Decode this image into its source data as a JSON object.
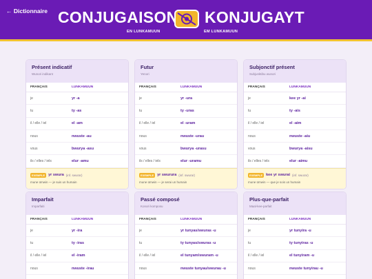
{
  "header": {
    "back_label": "← Dictionnaire",
    "title_left": "CONJUGAISON",
    "title_right": "KONJUGAYT",
    "sub_left": "EN LUNKAMUUN",
    "sub_right": "EM LUNKAMUUN",
    "colors": {
      "background": "#6a1bb5",
      "accent": "#f2c230"
    }
  },
  "columns": {
    "fr": "FRANÇAIS",
    "lk": "LUNKAMUUN"
  },
  "pronouns": [
    "je",
    "tu",
    "il / elle / iel",
    "nous",
    "vous",
    "ils / elles / iels"
  ],
  "cards": [
    {
      "title": "Présent indicatif",
      "subtitle": "Wunori indikant",
      "forms": [
        "yr -a",
        "ty -as",
        "el -am",
        "nwuste -au",
        "bwurya -asu",
        "elur -amu"
      ],
      "example": {
        "badge": "EXEMPLE",
        "text": "yr swura",
        "pron": "(inf. swurar)",
        "trans": "mune ümwin — je suis un humain"
      }
    },
    {
      "title": "Futur",
      "subtitle": "Yenori",
      "forms": [
        "yr -ura",
        "ty -uras",
        "el -uram",
        "nwuste -urau",
        "bwurya -urasu",
        "elur -uramu"
      ],
      "example": {
        "badge": "EXEMPLE",
        "text": "yr swurura",
        "pron": "(inf. swurar)",
        "trans": "mune ümwin — je serai un humain"
      }
    },
    {
      "title": "Subjonctif présent",
      "subtitle": "Subjunktibu wunori",
      "forms": [
        "kee yr -ai",
        "ty -ais",
        "el -aim",
        "nwuste -aiu",
        "bwurya -aisu",
        "elur -aimu"
      ],
      "example": {
        "badge": "EXEMPLE",
        "text": "kee yr swurai",
        "pron": "(inf. swurar)",
        "trans": "mune ümwin — que je sois un humain"
      }
    },
    {
      "title": "Imparfait",
      "subtitle": "Imparfaiti",
      "forms": [
        "yr -ira",
        "ty -iras",
        "el -iram",
        "nwuste -irau",
        "",
        ""
      ]
    },
    {
      "title": "Passé composé",
      "subtitle": "Konori komposu",
      "forms": [
        "yr tunyas/swuras -u",
        "ty tunyas/swuras -u",
        "el tunyam/swuram -u",
        "nwuste tunyau/swurau -u",
        "",
        ""
      ]
    },
    {
      "title": "Plus-que-parfait",
      "subtitle": "Maal-kee-parfait",
      "forms": [
        "yr tunyira -u",
        "ty tunyiras -u",
        "el tunyiram -u",
        "nwuste tunyirau -u",
        "",
        ""
      ]
    }
  ]
}
